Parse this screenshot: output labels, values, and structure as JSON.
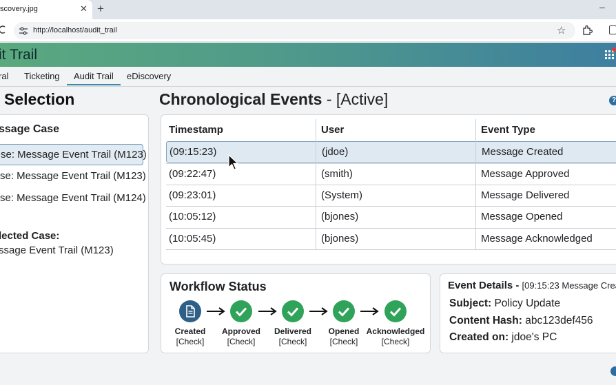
{
  "browser": {
    "tab_title": "scovery.jpg",
    "url": "http://localhost/audit_trail"
  },
  "app": {
    "title": "it Trail"
  },
  "nav": {
    "tabs": [
      {
        "label": "ral"
      },
      {
        "label": "Ticketing"
      },
      {
        "label": "Audit Trail",
        "active": true
      },
      {
        "label": "eDiscovery"
      }
    ]
  },
  "left": {
    "heading": "Selection",
    "case_title": "ssage Case",
    "cases": [
      {
        "label": "se: Message Event Trail (M123)",
        "selected": true
      },
      {
        "label": "se: Message Event Trail (M123)"
      },
      {
        "label": "se: Message Event Trail (M124)"
      }
    ],
    "selected_label": "lected Case:",
    "selected_value": "ssage Event Trail (M123)"
  },
  "main": {
    "heading": "Chronological Events",
    "heading_suffix": " - [Active]"
  },
  "table": {
    "headers": [
      "Timestamp",
      "User",
      "Event Type"
    ],
    "rows": [
      {
        "timestamp": "(09:15:23)",
        "user": "(jdoe)",
        "event": "Message Created",
        "selected": true
      },
      {
        "timestamp": "(09:22:47)",
        "user": "(smith)",
        "event": "Message Approved"
      },
      {
        "timestamp": "(09:23:01)",
        "user": "(System)",
        "event": "Message Delivered"
      },
      {
        "timestamp": "(10:05:12)",
        "user": "(bjones)",
        "event": "Message Opened"
      },
      {
        "timestamp": "(10:05:45)",
        "user": "(bjones)",
        "event": "Message Acknowledged"
      }
    ]
  },
  "workflow": {
    "title": "Workflow Status",
    "steps": [
      {
        "label": "Created",
        "sub": "[Check]",
        "icon": "document-icon"
      },
      {
        "label": "Approved",
        "sub": "[Check]",
        "icon": "check-icon"
      },
      {
        "label": "Delivered",
        "sub": "[Check]",
        "icon": "check-icon"
      },
      {
        "label": "Opened",
        "sub": "[Check]",
        "icon": "check-icon"
      },
      {
        "label": "Acknowledged",
        "sub": "[Check]",
        "icon": "check-icon"
      }
    ]
  },
  "details": {
    "title": "Event Details - ",
    "title_ts": "[09:15:23 Message Crea",
    "subject_label": "Subject:",
    "subject_value": " Policy Update",
    "hash_label": "Content Hash:",
    "hash_value": " abc123def456",
    "created_label": "Created on:",
    "created_value": " jdoe's PC"
  },
  "colors": {
    "header_start": "#5aa97f",
    "header_end": "#3e7fa0",
    "success": "#2fa35a",
    "doc_step": "#2e5f86",
    "selected_row": "#dfe9f1"
  }
}
